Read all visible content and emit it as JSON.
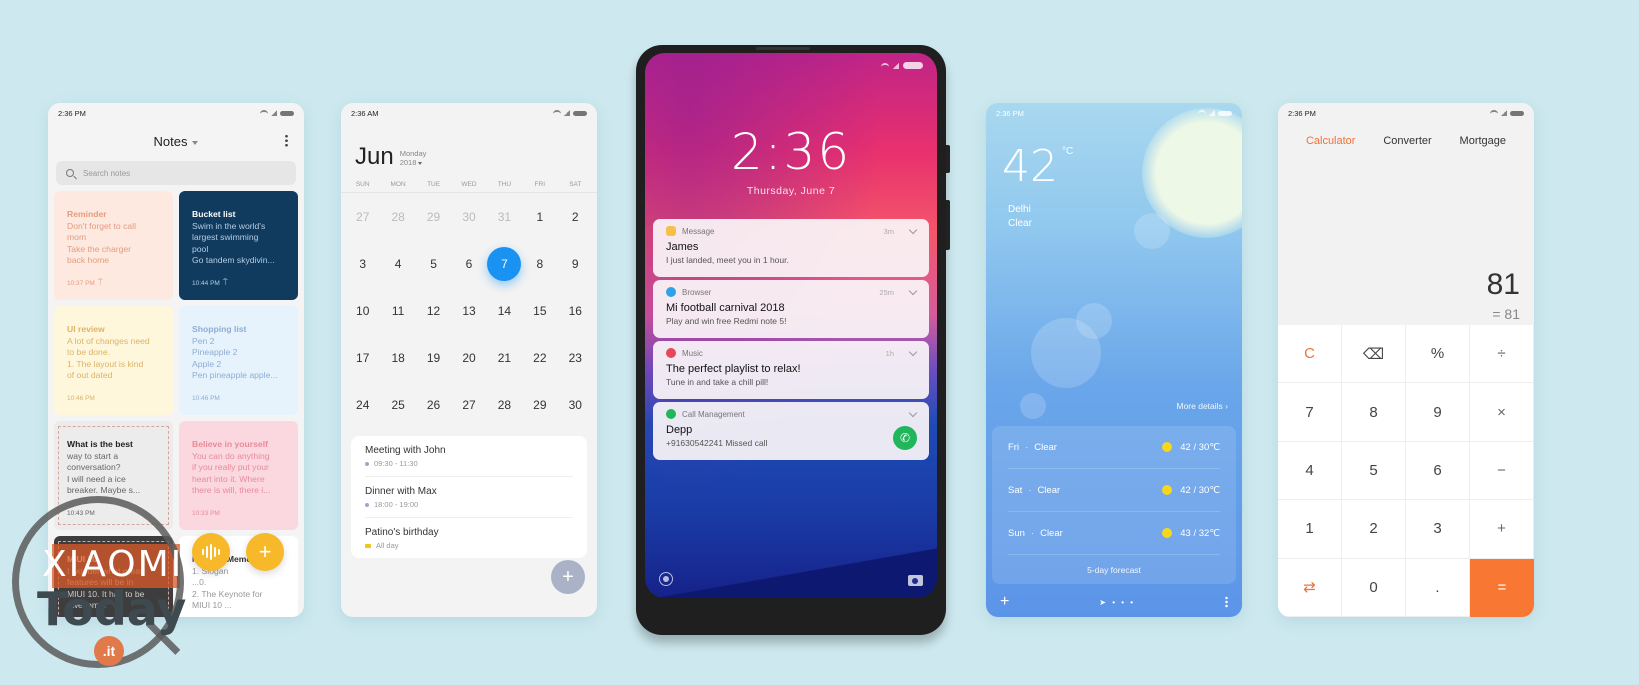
{
  "notes_app": {
    "status_time": "2:36 PM",
    "title": "Notes",
    "search_placeholder": "Search notes",
    "notes": [
      {
        "title": "Reminder",
        "body": "Don't forget to call\nmom\nTake the charger\nback home",
        "time": "10:37 PM",
        "pinned": true
      },
      {
        "title": "Bucket list",
        "body": "Swim in the world's\nlargest swimming\npool\nGo tandem skydivin...",
        "time": "10:44 PM",
        "pinned": true
      },
      {
        "title": "UI review",
        "body": "A lot of changes need\nto be done.\n1. The layout is kind\nof out dated",
        "time": "10:46 PM"
      },
      {
        "title": "Shopping list",
        "body": "Pen 2\nPineapple 2\nApple 2\nPen pineapple apple...",
        "time": "10:46 PM"
      },
      {
        "title": "What is the best",
        "body": "way to start a\nconversation?\nI will need a ice\nbreaker.  Maybe s...",
        "time": "10:43 PM"
      },
      {
        "title": "Believe in yourself",
        "body": "You can do anything\nif you really put your\nheart into it.  Where\nthere is will, there i...",
        "time": "10:33 PM"
      },
      {
        "title": "MIUI 10",
        "body": "I wonder what great\nfeatures will be in\nMIUI 10. It has to be\nawesome!",
        "time": ""
      },
      {
        "title": "Meeting Memo",
        "body": "1. Slogan\n...0.\n2. The Keynote for\nMIUI 10 ...",
        "time": ""
      }
    ],
    "fab_voice": "voice-note",
    "fab_add": "+"
  },
  "watermark": {
    "brand_top": "XIAOMI",
    "brand_bottom": "Today",
    "suffix": ".it"
  },
  "calendar_app": {
    "status_time": "2:36 AM",
    "month": "Jun",
    "weekday": "Monday",
    "year": "2018",
    "weekdays": [
      "SUN",
      "MON",
      "TUE",
      "WED",
      "THU",
      "FRI",
      "SAT"
    ],
    "days": [
      {
        "d": "27",
        "muted": true
      },
      {
        "d": "28",
        "muted": true
      },
      {
        "d": "29",
        "muted": true
      },
      {
        "d": "30",
        "muted": true
      },
      {
        "d": "31",
        "muted": true
      },
      {
        "d": "1"
      },
      {
        "d": "2"
      },
      {
        "d": "3"
      },
      {
        "d": "4"
      },
      {
        "d": "5"
      },
      {
        "d": "6"
      },
      {
        "d": "7",
        "today": true
      },
      {
        "d": "8"
      },
      {
        "d": "9"
      },
      {
        "d": "10"
      },
      {
        "d": "11"
      },
      {
        "d": "12"
      },
      {
        "d": "13"
      },
      {
        "d": "14"
      },
      {
        "d": "15"
      },
      {
        "d": "16"
      },
      {
        "d": "17"
      },
      {
        "d": "18"
      },
      {
        "d": "19"
      },
      {
        "d": "20"
      },
      {
        "d": "21"
      },
      {
        "d": "22"
      },
      {
        "d": "23"
      },
      {
        "d": "24"
      },
      {
        "d": "25"
      },
      {
        "d": "26"
      },
      {
        "d": "27"
      },
      {
        "d": "28"
      },
      {
        "d": "29"
      },
      {
        "d": "30"
      }
    ],
    "events": [
      {
        "title": "Meeting with John",
        "time": "09:30 - 11:30",
        "color": "#b79ad0"
      },
      {
        "title": "Dinner with Max",
        "time": "18:00 - 19:00",
        "color": "#b79ad0"
      },
      {
        "title": "Patino's birthday",
        "time": "All day",
        "color": "#f0c419"
      }
    ],
    "fab_add": "+"
  },
  "lockscreen": {
    "clock": "2:36",
    "date": "Thursday, June 7",
    "notifications": [
      {
        "app": "Message",
        "age": "3m",
        "title": "James",
        "body": "I just landed, meet you in 1 hour.",
        "icon_color": "#f5c04a"
      },
      {
        "app": "Browser",
        "age": "25m",
        "title": "Mi football carnival 2018",
        "body": "Play and win free Redmi note 5!",
        "icon_color": "#2fa3e8"
      },
      {
        "app": "Music",
        "age": "1h",
        "title": "The perfect playlist to relax!",
        "body": "Tune in and take a chill pill!",
        "icon_color": "#e8475a"
      },
      {
        "app": "Call Management",
        "age": "",
        "title": "Depp",
        "body": "+91630542241 Missed call",
        "icon_color": "#21b55c"
      }
    ]
  },
  "weather_app": {
    "status_time": "2:36 PM",
    "temperature": "42",
    "unit": "°C",
    "city": "Delhi",
    "condition": "Clear",
    "more_details": "More details  ›",
    "forecast": [
      {
        "day": "Fri",
        "condition": "Clear",
        "range": "42 / 30℃"
      },
      {
        "day": "Sat",
        "condition": "Clear",
        "range": "42 / 30℃"
      },
      {
        "day": "Sun",
        "condition": "Clear",
        "range": "43 / 32℃"
      }
    ],
    "forecast_link": "5-day forecast",
    "add_label": "+",
    "page_dots": "➤ • • •"
  },
  "calculator_app": {
    "status_time": "2:36 PM",
    "tabs": [
      "Calculator",
      "Converter",
      "Mortgage"
    ],
    "active_tab": 0,
    "expression": "81",
    "result": "=  81",
    "keys": [
      "C",
      "⌫",
      "%",
      "÷",
      "7",
      "8",
      "9",
      "×",
      "4",
      "5",
      "6",
      "−",
      "1",
      "2",
      "3",
      "+",
      "⇄",
      "0",
      ".",
      "="
    ],
    "accent_color": "#f87732"
  }
}
